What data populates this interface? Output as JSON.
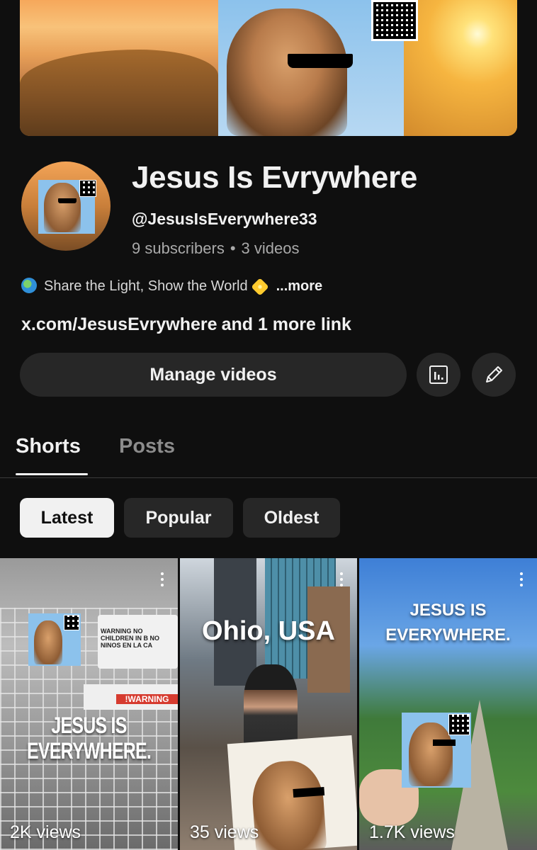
{
  "channel": {
    "name": "Jesus Is Evrywhere",
    "handle": "@JesusIsEverywhere33",
    "subscribers": "9 subscribers",
    "separator": "•",
    "videos": "3 videos",
    "description": "Share the Light, Show the World",
    "description_more": "...more",
    "link_primary": "x.com/JesusEvrywhere",
    "link_more": "and 1 more link"
  },
  "actions": {
    "manage_label": "Manage videos",
    "analytics_icon": "analytics-icon",
    "edit_icon": "pencil-icon"
  },
  "tabs": [
    {
      "label": "Shorts",
      "active": true
    },
    {
      "label": "Posts",
      "active": false
    }
  ],
  "sort_chips": [
    {
      "label": "Latest",
      "selected": true
    },
    {
      "label": "Popular",
      "selected": false
    },
    {
      "label": "Oldest",
      "selected": false
    }
  ],
  "shorts": [
    {
      "overlay": "JESUS IS EVERYWHERE.",
      "views": "2K views",
      "sign_text": "WARNING NO CHILDREN IN B NO NINOS EN LA CA",
      "warning_band": "!WARNING"
    },
    {
      "overlay": "Ohio, USA",
      "views": "35 views"
    },
    {
      "overlay": "JESUS IS EVERYWHERE.",
      "views": "1.7K views"
    }
  ],
  "colors": {
    "background": "#0f0f0f",
    "surface": "#272727",
    "text": "#f1f1f1",
    "muted": "#aaaaaa",
    "chip_selected_bg": "#f1f1f1"
  }
}
